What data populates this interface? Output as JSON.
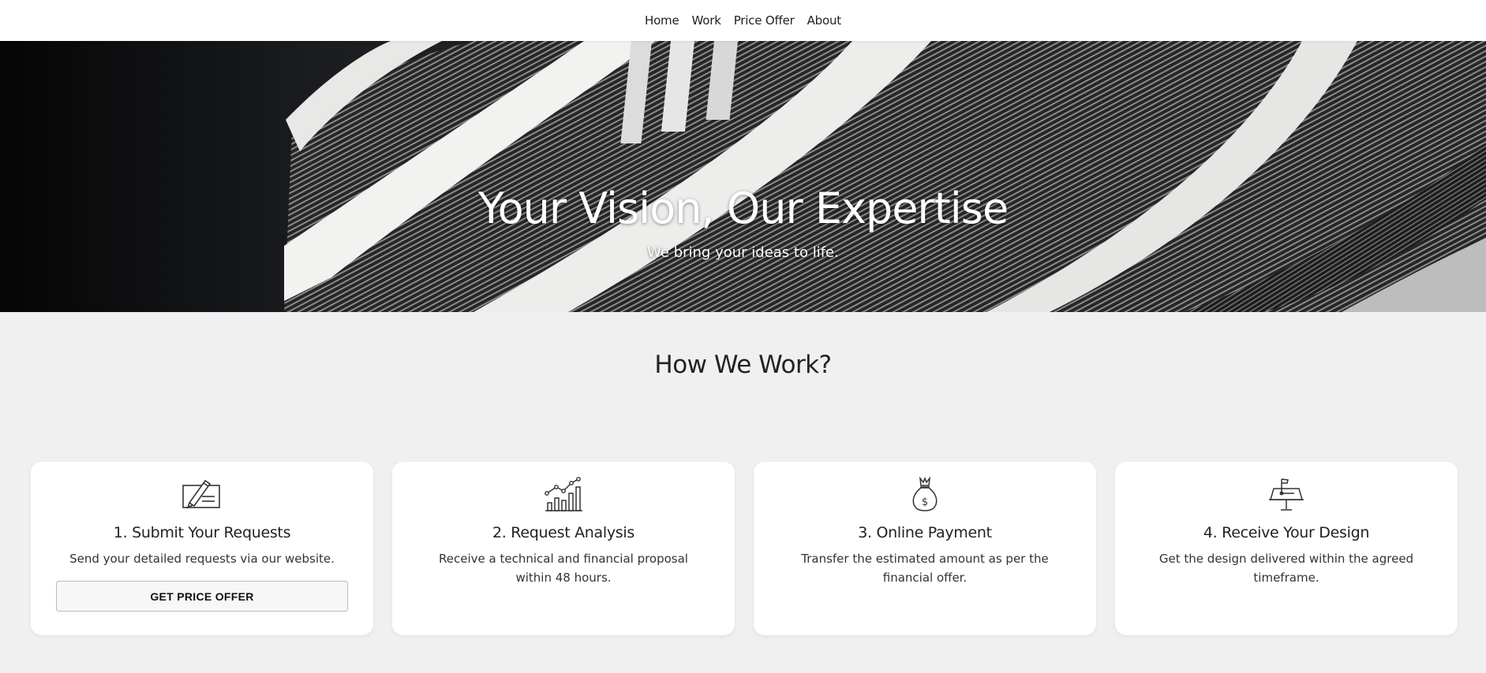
{
  "nav": {
    "items": [
      {
        "label": "Home"
      },
      {
        "label": "Work"
      },
      {
        "label": "Price Offer"
      },
      {
        "label": "About"
      }
    ]
  },
  "hero": {
    "title": "Your Vision, Our Expertise",
    "subtitle": "We bring your ideas to life."
  },
  "how_we_work": {
    "title": "How We Work?",
    "steps": [
      {
        "icon": "contract-pen-icon",
        "title": "1. Submit Your Requests",
        "text": "Send your detailed requests via our website.",
        "button_label": "GET PRICE OFFER"
      },
      {
        "icon": "growth-chart-icon",
        "title": "2. Request Analysis",
        "text": "Receive a technical and financial proposal within 48 hours."
      },
      {
        "icon": "money-bag-icon",
        "title": "3. Online Payment",
        "text": "Transfer the estimated amount as per the financial offer."
      },
      {
        "icon": "design-board-icon",
        "title": "4. Receive Your Design",
        "text": "Get the design delivered within the agreed timeframe."
      }
    ]
  },
  "colors": {
    "page_background": "#f0f0f0",
    "card_background": "#ffffff",
    "text": "#222222"
  }
}
